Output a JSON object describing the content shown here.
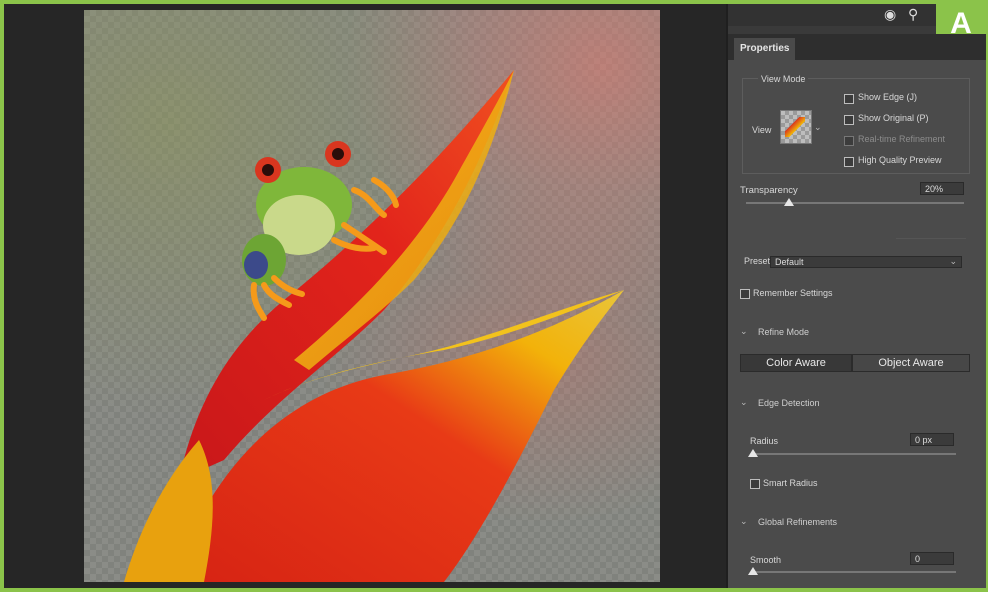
{
  "badge": {
    "letter": "A",
    "color": "#8bc34a"
  },
  "topbar_icons": [
    "user-add-icon",
    "search-icon"
  ],
  "tabs": [
    {
      "label": "Properties"
    }
  ],
  "view_mode": {
    "title": "View Mode",
    "view_label": "View",
    "show_edge": "Show Edge (J)",
    "show_original": "Show Original (P)",
    "realtime": "Real-time Refinement",
    "high_quality": "High Quality Preview"
  },
  "transparency": {
    "label": "Transparency",
    "value": "20%",
    "level": 0.2
  },
  "preset": {
    "label": "Preset",
    "value": "Default"
  },
  "remember": {
    "label": "Remember Settings"
  },
  "refine_mode": {
    "title": "Refine Mode",
    "options": [
      "Color Aware",
      "Object Aware"
    ],
    "selected": "Color Aware"
  },
  "edge_detection": {
    "title": "Edge Detection",
    "radius_label": "Radius",
    "radius_value": "0 px",
    "smart_radius": "Smart Radius"
  },
  "global_refinements": {
    "title": "Global Refinements",
    "smooth_label": "Smooth",
    "smooth_value": "0"
  }
}
